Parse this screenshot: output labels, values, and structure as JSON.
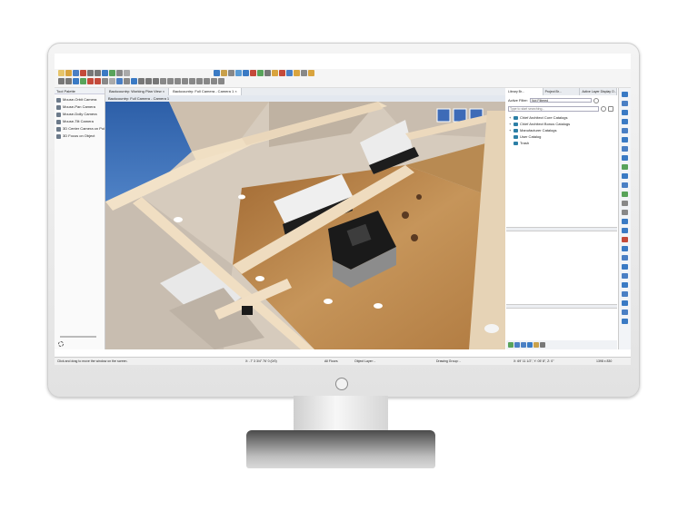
{
  "tabs": [
    {
      "label": "Backcountry: Working Plan View"
    },
    {
      "label": "Backcountry: Full Camera - Camera 1"
    }
  ],
  "viewport_title": "Backcountry: Full Camera - Camera 1",
  "tool_palette": {
    "title": "Tool Palette",
    "items": [
      {
        "label": "Mouse-Orbit Camera"
      },
      {
        "label": "Mouse-Pan Camera"
      },
      {
        "label": "Mouse-Dolly Camera"
      },
      {
        "label": "Mouse-Tilt Camera"
      },
      {
        "label": "3D Center Camera on Poi"
      },
      {
        "label": "3D Focus on Object"
      }
    ]
  },
  "right_tabs": [
    {
      "label": "Library Br..."
    },
    {
      "label": "Project Br..."
    },
    {
      "label": "Active Layer Display O..."
    }
  ],
  "library": {
    "filter_label": "Active Filter:",
    "filter_value": "Not Filtered",
    "search_placeholder": "Type to start searching...",
    "items": [
      {
        "label": "Chief Architect Core Catalogs"
      },
      {
        "label": "Chief Architect Bonus Catalogs"
      },
      {
        "label": "Manufacturer Catalogs"
      },
      {
        "label": "User Catalog"
      },
      {
        "label": "Trash"
      }
    ]
  },
  "statusbar": {
    "hint": "Click and drag to move the window on the screen.",
    "coords": "X: -7' 3 3/4\" 76' 0 (0/0)",
    "floors": "All Floors",
    "layer": "Object Layer: -",
    "drawing_group": "Drawing Group: -",
    "position": "X: 69' 11 1/2\", Y: 05' 8\", Z: 0\"",
    "size": "1398 x 830"
  },
  "colors": {
    "accent": "#2c7fa6",
    "floor_wood": "#b5854a",
    "walls": "#f0ddc4",
    "countertop": "#1e1e1e",
    "sky": "#3a6bb0"
  }
}
